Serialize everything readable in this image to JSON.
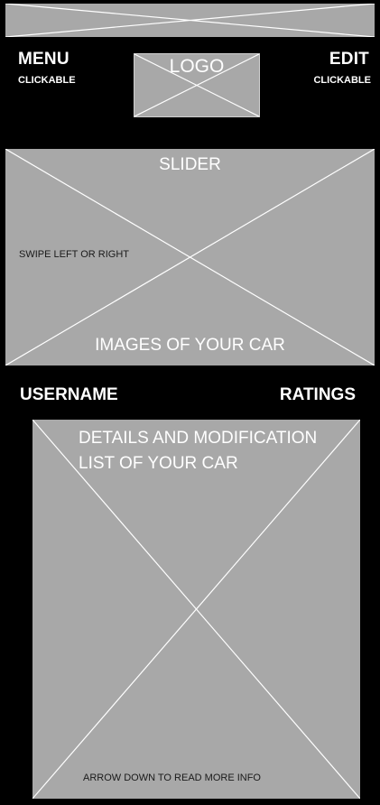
{
  "status_bar": {
    "icon": "image-placeholder-icon"
  },
  "header": {
    "menu_label": "MENU",
    "menu_caption": "CLICKABLE",
    "logo_label": "LOGO",
    "edit_label": "EDIT",
    "edit_caption": "CLICKABLE"
  },
  "slider": {
    "title": "SLIDER",
    "hint": "SWIPE LEFT OR RIGHT",
    "footer": "IMAGES OF YOUR CAR"
  },
  "profile": {
    "username": "USERNAME",
    "ratings": "RATINGS"
  },
  "details": {
    "title_line1": "DETAILS AND MODIFICATION",
    "title_line2": "LIST OF YOUR CAR",
    "footer": "ARROW DOWN TO READ MORE INFO"
  },
  "colors": {
    "background": "#000000",
    "placeholder": "#a8a8a8",
    "text": "#ffffff",
    "lines": "#ffffff"
  }
}
